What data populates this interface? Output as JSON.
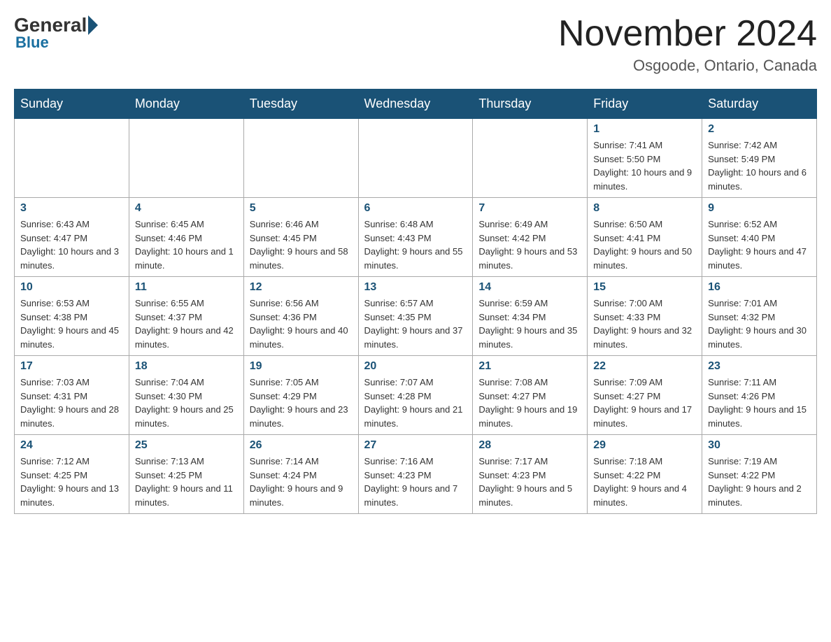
{
  "logo": {
    "general": "General",
    "blue": "Blue"
  },
  "title": "November 2024",
  "location": "Osgoode, Ontario, Canada",
  "days_header": [
    "Sunday",
    "Monday",
    "Tuesday",
    "Wednesday",
    "Thursday",
    "Friday",
    "Saturday"
  ],
  "weeks": [
    [
      {
        "day": "",
        "info": ""
      },
      {
        "day": "",
        "info": ""
      },
      {
        "day": "",
        "info": ""
      },
      {
        "day": "",
        "info": ""
      },
      {
        "day": "",
        "info": ""
      },
      {
        "day": "1",
        "info": "Sunrise: 7:41 AM\nSunset: 5:50 PM\nDaylight: 10 hours and 9 minutes."
      },
      {
        "day": "2",
        "info": "Sunrise: 7:42 AM\nSunset: 5:49 PM\nDaylight: 10 hours and 6 minutes."
      }
    ],
    [
      {
        "day": "3",
        "info": "Sunrise: 6:43 AM\nSunset: 4:47 PM\nDaylight: 10 hours and 3 minutes."
      },
      {
        "day": "4",
        "info": "Sunrise: 6:45 AM\nSunset: 4:46 PM\nDaylight: 10 hours and 1 minute."
      },
      {
        "day": "5",
        "info": "Sunrise: 6:46 AM\nSunset: 4:45 PM\nDaylight: 9 hours and 58 minutes."
      },
      {
        "day": "6",
        "info": "Sunrise: 6:48 AM\nSunset: 4:43 PM\nDaylight: 9 hours and 55 minutes."
      },
      {
        "day": "7",
        "info": "Sunrise: 6:49 AM\nSunset: 4:42 PM\nDaylight: 9 hours and 53 minutes."
      },
      {
        "day": "8",
        "info": "Sunrise: 6:50 AM\nSunset: 4:41 PM\nDaylight: 9 hours and 50 minutes."
      },
      {
        "day": "9",
        "info": "Sunrise: 6:52 AM\nSunset: 4:40 PM\nDaylight: 9 hours and 47 minutes."
      }
    ],
    [
      {
        "day": "10",
        "info": "Sunrise: 6:53 AM\nSunset: 4:38 PM\nDaylight: 9 hours and 45 minutes."
      },
      {
        "day": "11",
        "info": "Sunrise: 6:55 AM\nSunset: 4:37 PM\nDaylight: 9 hours and 42 minutes."
      },
      {
        "day": "12",
        "info": "Sunrise: 6:56 AM\nSunset: 4:36 PM\nDaylight: 9 hours and 40 minutes."
      },
      {
        "day": "13",
        "info": "Sunrise: 6:57 AM\nSunset: 4:35 PM\nDaylight: 9 hours and 37 minutes."
      },
      {
        "day": "14",
        "info": "Sunrise: 6:59 AM\nSunset: 4:34 PM\nDaylight: 9 hours and 35 minutes."
      },
      {
        "day": "15",
        "info": "Sunrise: 7:00 AM\nSunset: 4:33 PM\nDaylight: 9 hours and 32 minutes."
      },
      {
        "day": "16",
        "info": "Sunrise: 7:01 AM\nSunset: 4:32 PM\nDaylight: 9 hours and 30 minutes."
      }
    ],
    [
      {
        "day": "17",
        "info": "Sunrise: 7:03 AM\nSunset: 4:31 PM\nDaylight: 9 hours and 28 minutes."
      },
      {
        "day": "18",
        "info": "Sunrise: 7:04 AM\nSunset: 4:30 PM\nDaylight: 9 hours and 25 minutes."
      },
      {
        "day": "19",
        "info": "Sunrise: 7:05 AM\nSunset: 4:29 PM\nDaylight: 9 hours and 23 minutes."
      },
      {
        "day": "20",
        "info": "Sunrise: 7:07 AM\nSunset: 4:28 PM\nDaylight: 9 hours and 21 minutes."
      },
      {
        "day": "21",
        "info": "Sunrise: 7:08 AM\nSunset: 4:27 PM\nDaylight: 9 hours and 19 minutes."
      },
      {
        "day": "22",
        "info": "Sunrise: 7:09 AM\nSunset: 4:27 PM\nDaylight: 9 hours and 17 minutes."
      },
      {
        "day": "23",
        "info": "Sunrise: 7:11 AM\nSunset: 4:26 PM\nDaylight: 9 hours and 15 minutes."
      }
    ],
    [
      {
        "day": "24",
        "info": "Sunrise: 7:12 AM\nSunset: 4:25 PM\nDaylight: 9 hours and 13 minutes."
      },
      {
        "day": "25",
        "info": "Sunrise: 7:13 AM\nSunset: 4:25 PM\nDaylight: 9 hours and 11 minutes."
      },
      {
        "day": "26",
        "info": "Sunrise: 7:14 AM\nSunset: 4:24 PM\nDaylight: 9 hours and 9 minutes."
      },
      {
        "day": "27",
        "info": "Sunrise: 7:16 AM\nSunset: 4:23 PM\nDaylight: 9 hours and 7 minutes."
      },
      {
        "day": "28",
        "info": "Sunrise: 7:17 AM\nSunset: 4:23 PM\nDaylight: 9 hours and 5 minutes."
      },
      {
        "day": "29",
        "info": "Sunrise: 7:18 AM\nSunset: 4:22 PM\nDaylight: 9 hours and 4 minutes."
      },
      {
        "day": "30",
        "info": "Sunrise: 7:19 AM\nSunset: 4:22 PM\nDaylight: 9 hours and 2 minutes."
      }
    ]
  ]
}
